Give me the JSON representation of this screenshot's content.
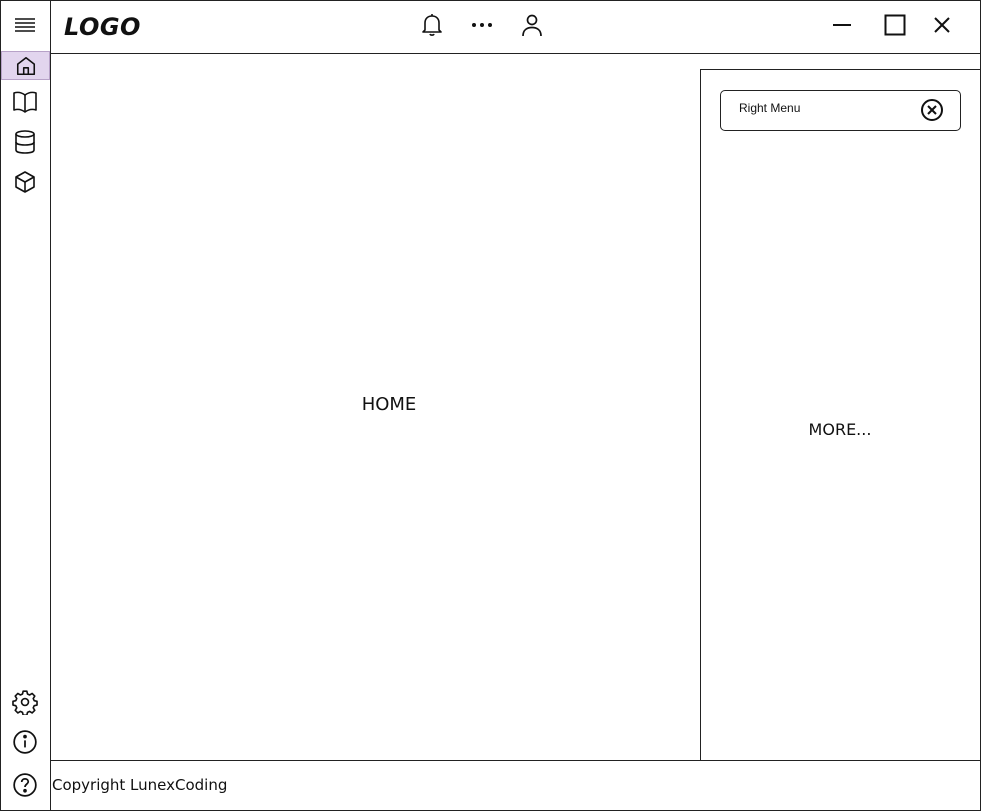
{
  "header": {
    "logo": "LOGO"
  },
  "sidebar": {
    "menu_icon": "hamburger-icon",
    "items": [
      {
        "id": "home",
        "icon": "home-icon",
        "active": true
      },
      {
        "id": "book",
        "icon": "book-open-icon",
        "active": false
      },
      {
        "id": "database",
        "icon": "database-icon",
        "active": false
      },
      {
        "id": "box",
        "icon": "box-icon",
        "active": false
      }
    ],
    "bottom_items": [
      {
        "id": "settings",
        "icon": "gear-icon"
      },
      {
        "id": "info",
        "icon": "info-icon"
      },
      {
        "id": "help",
        "icon": "help-icon"
      }
    ]
  },
  "header_actions": [
    "bell-icon",
    "more-icon",
    "user-icon"
  ],
  "window_controls": [
    "minimize-icon",
    "maximize-icon",
    "close-icon"
  ],
  "main": {
    "title": "HOME"
  },
  "right_panel": {
    "menu_label": "Right Menu",
    "close_icon": "circle-x-icon",
    "more": "MORE..."
  },
  "footer": {
    "copyright": "Copyright LunexCoding"
  },
  "colors": {
    "active_nav_bg": "#e2d5ee",
    "stroke": "#222222"
  }
}
